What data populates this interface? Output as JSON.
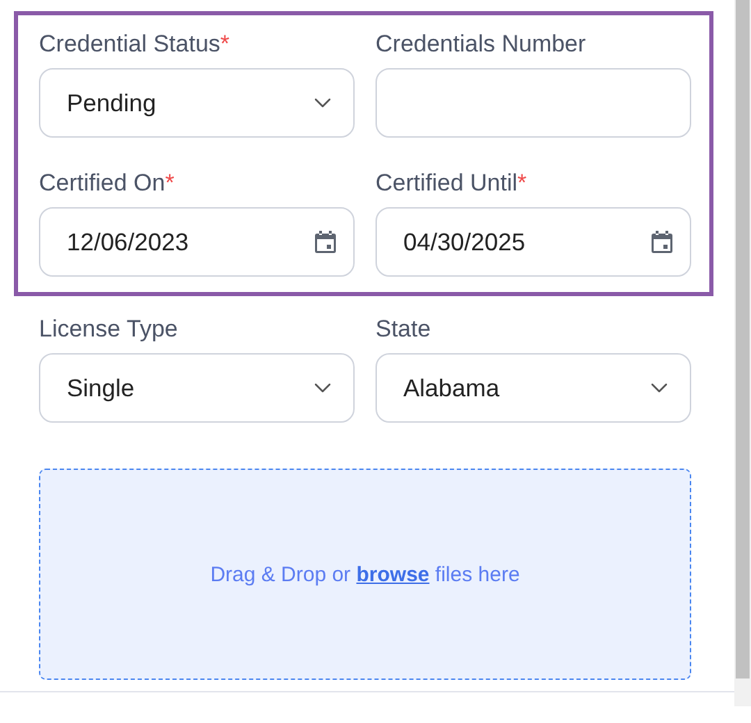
{
  "groups": [
    {
      "highlighted": true,
      "fields": [
        {
          "kind": "select",
          "label": "Credential Status",
          "required_mark": "*",
          "value": "Pending"
        },
        {
          "kind": "text",
          "label": "Credentials Number"
        },
        {
          "kind": "date",
          "label": "Certified On",
          "required_mark": "*",
          "value": "12/06/2023"
        },
        {
          "kind": "date",
          "label": "Certified Until",
          "required_mark": "*",
          "value": "04/30/2025"
        }
      ]
    },
    {
      "highlighted": false,
      "fields": [
        {
          "kind": "select",
          "label": "License Type",
          "value": "Single"
        },
        {
          "kind": "select",
          "label": "State",
          "value": "Alabama"
        }
      ]
    }
  ],
  "drop_zone": {
    "prefix": "Drag & Drop or",
    "link": "browse",
    "suffix": "files here"
  }
}
